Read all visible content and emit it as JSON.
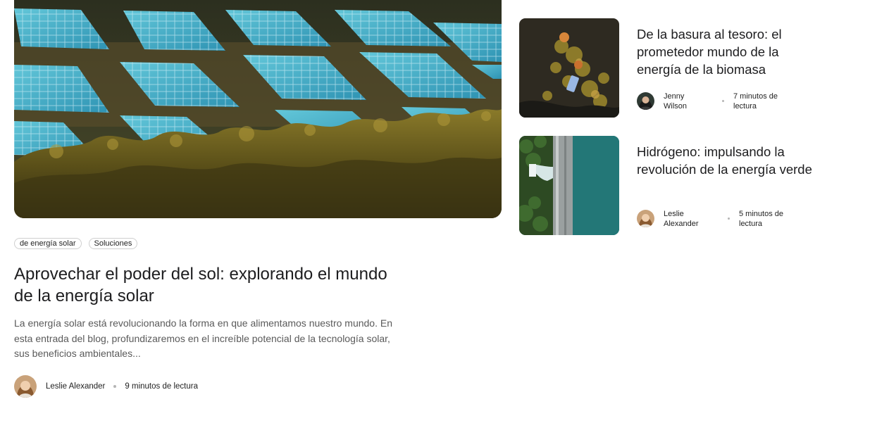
{
  "featured": {
    "image": "solar-panels-field-photo",
    "tags": [
      "de energía solar",
      "Soluciones"
    ],
    "title": "Aprovechar el poder del sol: explorando el mundo de la energía solar",
    "excerpt": "La energía solar está revolucionando la forma en que alimentamos nuestro mundo. En esta entrada del blog, profundizaremos en el increíble potencial de la tecnología solar, sus beneficios ambientales...",
    "author": "Leslie Alexander",
    "read_time": "9 minutos de lectura"
  },
  "side_posts": [
    {
      "image": "biomass-debris-photo",
      "title": "De la basura al tesoro: el prometedor mundo de la energía de la biomasa",
      "author": "Jenny Wilson",
      "read_time": "7 minutos de lectura"
    },
    {
      "image": "hydro-dam-aerial-photo",
      "title": "Hidrógeno: impulsando la revolución de la energía verde",
      "author": "Leslie Alexander",
      "read_time": "5 minutos de lectura"
    }
  ],
  "colors": {
    "text": "#1d1d1f",
    "muted": "#5a5a5a",
    "tag_border": "#cfcfcf",
    "dot": "#b5b5b5"
  }
}
